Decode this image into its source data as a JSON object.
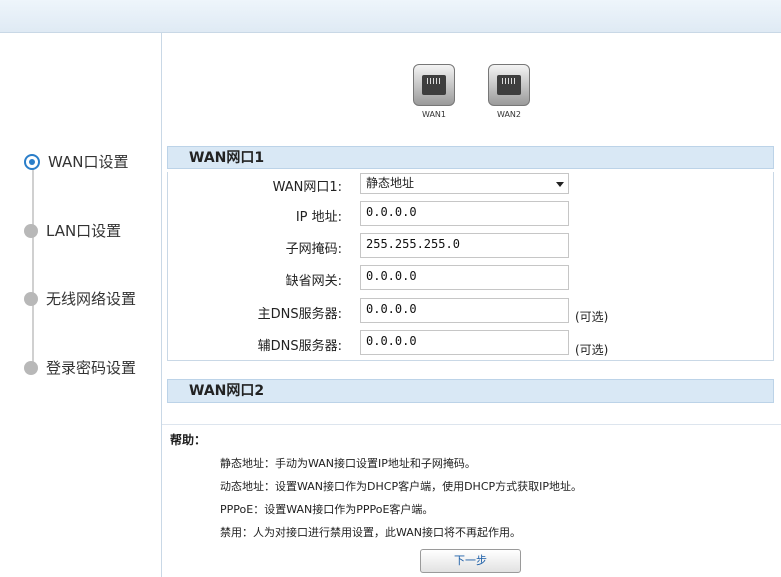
{
  "sidebar": {
    "steps": [
      {
        "label": "WAN口设置",
        "active": true
      },
      {
        "label": "LAN口设置",
        "active": false
      },
      {
        "label": "无线网络设置",
        "active": false
      },
      {
        "label": "登录密码设置",
        "active": false
      }
    ]
  },
  "ports": [
    {
      "label": "WAN1",
      "icon": "ethernet-port-icon"
    },
    {
      "label": "WAN2",
      "icon": "ethernet-port-icon"
    }
  ],
  "wan1": {
    "header": "WAN网口1",
    "type_label": "WAN网口1:",
    "type_value": "静态地址",
    "ip_label": "IP 地址:",
    "ip_value": "0.0.0.0",
    "mask_label": "子网掩码:",
    "mask_value": "255.255.255.0",
    "gateway_label": "缺省网关:",
    "gateway_value": "0.0.0.0",
    "dns1_label": "主DNS服务器:",
    "dns1_value": "0.0.0.0",
    "dns2_label": "辅DNS服务器:",
    "dns2_value": "0.0.0.0",
    "optional_text": "(可选)"
  },
  "wan2": {
    "header": "WAN网口2"
  },
  "help": {
    "title": "帮助：",
    "items": [
      "静态地址：手动为WAN接口设置IP地址和子网掩码。",
      "动态地址：设置WAN接口作为DHCP客户端，使用DHCP方式获取IP地址。",
      "PPPoE：设置WAN接口作为PPPoE客户端。",
      "禁用：人为对接口进行禁用设置，此WAN接口将不再起作用。"
    ]
  },
  "next_button": "下一步"
}
